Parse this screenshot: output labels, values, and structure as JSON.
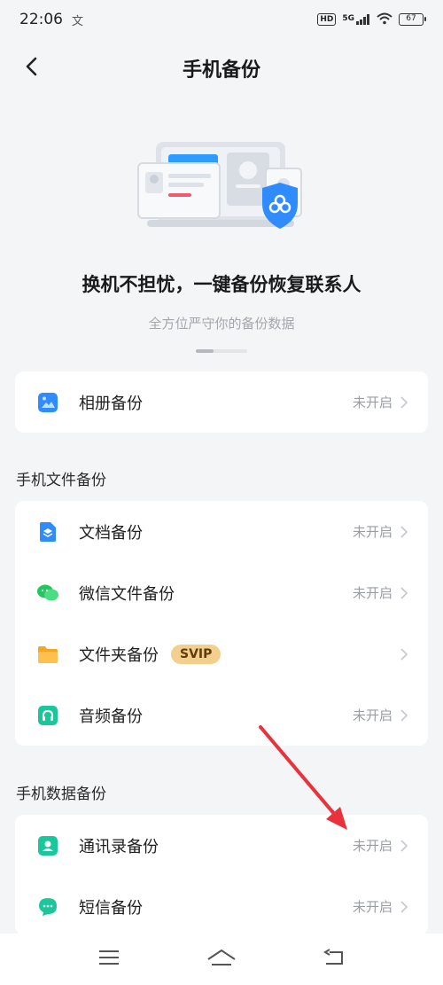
{
  "status_bar": {
    "time": "22:06",
    "extra_icon": "文",
    "hd_label": "HD",
    "network_label": "5G",
    "battery_level": "67"
  },
  "header": {
    "title": "手机备份",
    "back_icon": "chevron-left-icon"
  },
  "hero": {
    "title": "换机不担忧，一键备份恢复联系人",
    "subtitle": "全方位严守你的备份数据"
  },
  "album_card": {
    "items": [
      {
        "label": "相册备份",
        "status": "未开启",
        "icon": "photo-icon",
        "icon_color": "#2e8cff"
      }
    ]
  },
  "file_section": {
    "title": "手机文件备份",
    "items": [
      {
        "label": "文档备份",
        "status": "未开启",
        "icon": "document-icon",
        "icon_color": "#2e8cff"
      },
      {
        "label": "微信文件备份",
        "status": "未开启",
        "icon": "wechat-icon",
        "icon_color": "#22c55e"
      },
      {
        "label": "文件夹备份",
        "status": "",
        "badge": "SVIP",
        "icon": "folder-icon",
        "icon_color": "#f5a623"
      },
      {
        "label": "音频备份",
        "status": "未开启",
        "icon": "headphones-icon",
        "icon_color": "#19c79b"
      }
    ]
  },
  "data_section": {
    "title": "手机数据备份",
    "items": [
      {
        "label": "通讯录备份",
        "status": "未开启",
        "icon": "contacts-icon",
        "icon_color": "#19c79b"
      },
      {
        "label": "短信备份",
        "status": "未开启",
        "icon": "message-icon",
        "icon_color": "#19c79b"
      }
    ]
  },
  "nav_bar": {
    "buttons": [
      "menu-icon",
      "home-icon",
      "back-icon"
    ]
  },
  "colors": {
    "background": "#f4f5f7",
    "accent": "#2e8cff",
    "annotation_arrow": "#e8323c"
  }
}
